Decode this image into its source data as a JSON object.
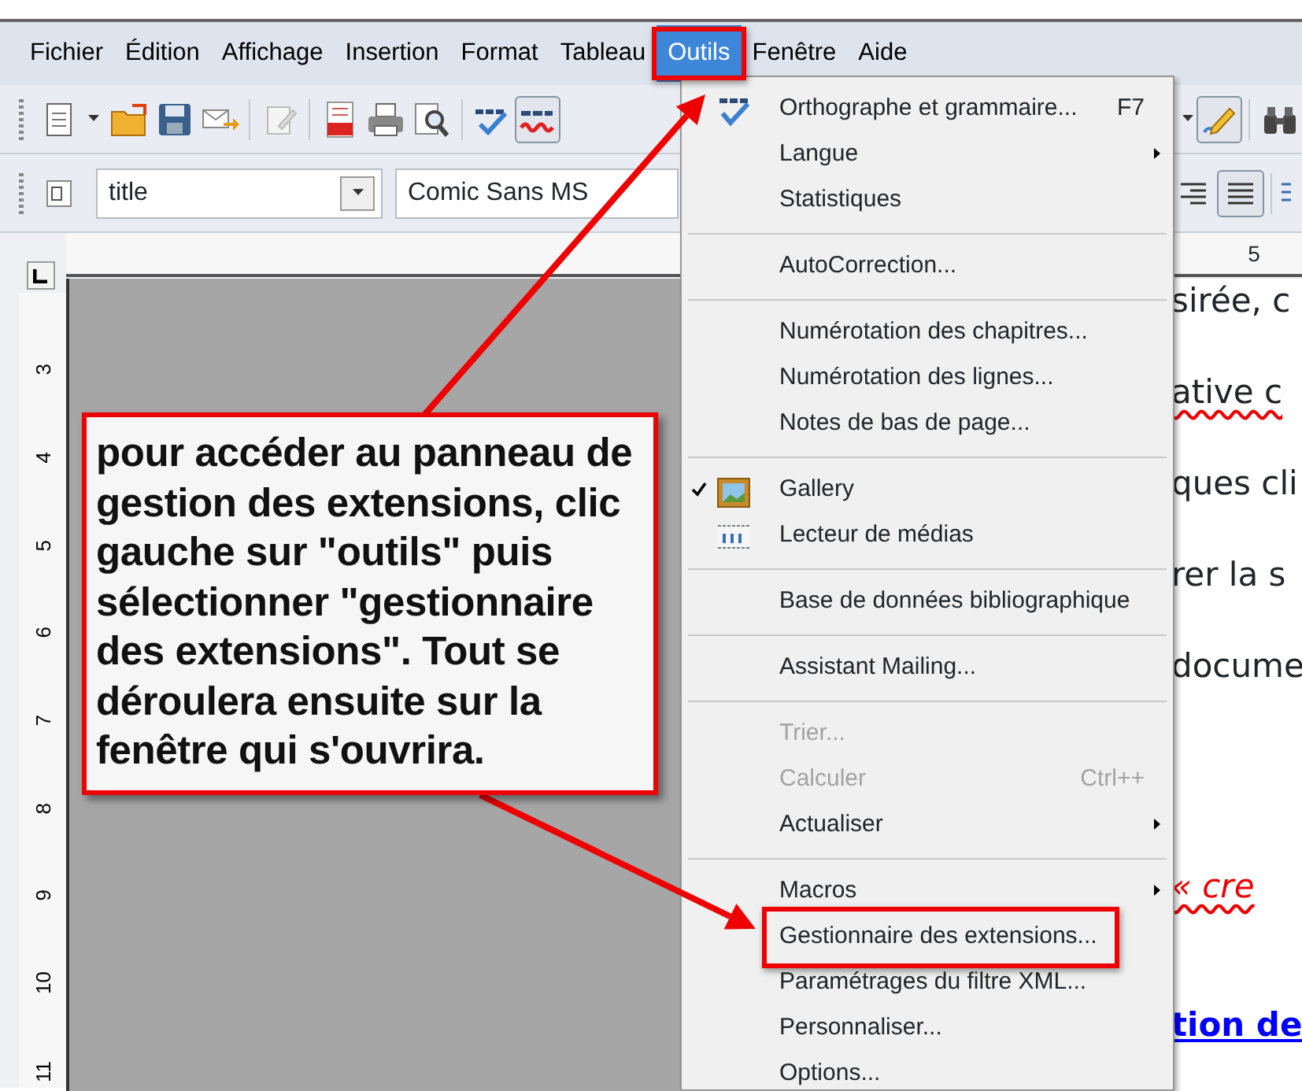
{
  "menubar": [
    {
      "label": "Fichier",
      "selected": false
    },
    {
      "label": "Édition",
      "selected": false
    },
    {
      "label": "Affichage",
      "selected": false
    },
    {
      "label": "Insertion",
      "selected": false
    },
    {
      "label": "Format",
      "selected": false
    },
    {
      "label": "Tableau",
      "selected": false
    },
    {
      "label": "Outils",
      "selected": true
    },
    {
      "label": "Fenêtre",
      "selected": false
    },
    {
      "label": "Aide",
      "selected": false
    }
  ],
  "standard_toolbar": {
    "auto_spellcheck_on": true,
    "draw_functions_on": true
  },
  "formatting_toolbar": {
    "paragraph_style": "title",
    "font_name": "Comic Sans MS",
    "justify_on": true
  },
  "rulers": {
    "horizontal": [
      "5"
    ],
    "vertical": [
      "3",
      "4",
      "5",
      "6",
      "7",
      "8",
      "9",
      "10",
      "11"
    ]
  },
  "document_lines": [
    {
      "text": "sirée, c",
      "kind": "plain"
    },
    {
      "text": "ative c",
      "kind": "misspelled"
    },
    {
      "text": "ques cli",
      "kind": "plain"
    },
    {
      "text": "rer la s",
      "kind": "plain"
    },
    {
      "text": "docume",
      "kind": "plain"
    },
    {
      "text": "« cre",
      "kind": "red"
    },
    {
      "text": "tion de",
      "kind": "link"
    }
  ],
  "tools_menu": [
    {
      "kind": "item",
      "label": "Orthographe et grammaire...",
      "shortcut": "F7",
      "submenu": false,
      "disabled": false,
      "checked": false,
      "annotated": false
    },
    {
      "kind": "item",
      "label": "Langue",
      "submenu": true,
      "disabled": false,
      "checked": false,
      "annotated": false
    },
    {
      "kind": "item",
      "label": "Statistiques",
      "submenu": false,
      "disabled": false,
      "checked": false,
      "annotated": false
    },
    {
      "kind": "separator"
    },
    {
      "kind": "item",
      "label": "AutoCorrection...",
      "submenu": false,
      "disabled": false,
      "checked": false,
      "annotated": false
    },
    {
      "kind": "separator"
    },
    {
      "kind": "item",
      "label": "Numérotation des chapitres...",
      "submenu": false,
      "disabled": false,
      "checked": false,
      "annotated": false
    },
    {
      "kind": "item",
      "label": "Numérotation des lignes...",
      "submenu": false,
      "disabled": false,
      "checked": false,
      "annotated": false
    },
    {
      "kind": "item",
      "label": "Notes de bas de page...",
      "submenu": false,
      "disabled": false,
      "checked": false,
      "annotated": false
    },
    {
      "kind": "separator"
    },
    {
      "kind": "item",
      "label": "Gallery",
      "submenu": false,
      "disabled": false,
      "checked": true,
      "annotated": false
    },
    {
      "kind": "item",
      "label": "Lecteur de médias",
      "submenu": false,
      "disabled": false,
      "checked": false,
      "annotated": false
    },
    {
      "kind": "separator"
    },
    {
      "kind": "item",
      "label": "Base de données bibliographique",
      "submenu": false,
      "disabled": false,
      "checked": false,
      "annotated": false
    },
    {
      "kind": "separator"
    },
    {
      "kind": "item",
      "label": "Assistant Mailing...",
      "submenu": false,
      "disabled": false,
      "checked": false,
      "annotated": false
    },
    {
      "kind": "separator"
    },
    {
      "kind": "item",
      "label": "Trier...",
      "submenu": false,
      "disabled": true,
      "checked": false,
      "annotated": false
    },
    {
      "kind": "item",
      "label": "Calculer",
      "shortcut": "Ctrl++",
      "submenu": false,
      "disabled": true,
      "checked": false,
      "annotated": false
    },
    {
      "kind": "item",
      "label": "Actualiser",
      "submenu": true,
      "disabled": false,
      "checked": false,
      "annotated": false
    },
    {
      "kind": "separator"
    },
    {
      "kind": "item",
      "label": "Macros",
      "submenu": true,
      "disabled": false,
      "checked": false,
      "annotated": false
    },
    {
      "kind": "item",
      "label": "Gestionnaire des extensions...",
      "submenu": false,
      "disabled": false,
      "checked": false,
      "annotated": true
    },
    {
      "kind": "item",
      "label": "Paramétrages du filtre XML...",
      "submenu": false,
      "disabled": false,
      "checked": false,
      "annotated": false
    },
    {
      "kind": "item",
      "label": "Personnaliser...",
      "submenu": false,
      "disabled": false,
      "checked": false,
      "annotated": false
    },
    {
      "kind": "item",
      "label": "Options...",
      "submenu": false,
      "disabled": false,
      "checked": false,
      "annotated": false
    }
  ],
  "callout": {
    "text": "pour accéder au panneau de gestion des extensions, clic gauche sur \"outils\" puis sélectionner \"gestionnaire des extensions\". Tout se déroulera ensuite sur la fenêtre qui s'ouvrira."
  }
}
